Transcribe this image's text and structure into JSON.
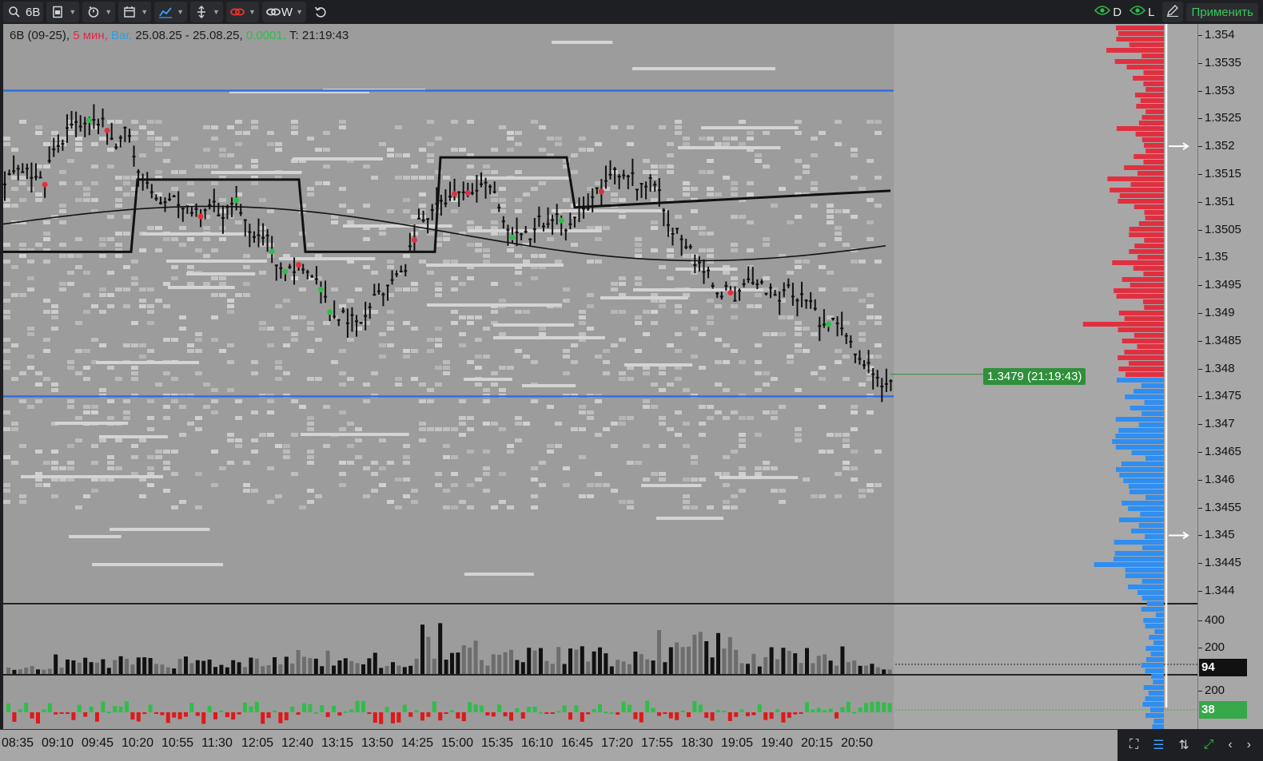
{
  "toolbar": {
    "symbol": "6B",
    "period_link": "W",
    "vis_d": "D",
    "vis_l": "L",
    "apply": "Применить"
  },
  "info": {
    "instrument": "6B  (09-25),",
    "timeframe": "5 мин,",
    "vol_mode": "Ваг,",
    "range": "25.08.25 - 25.08.25,",
    "tick": "0.0001,",
    "time": "T: 21:19:43"
  },
  "last_price_tag": "1.3479 (21:19:43)",
  "price_axis": [
    "1.354",
    "1.3535",
    "1.353",
    "1.3525",
    "1.352",
    "1.3515",
    "1.351",
    "1.3505",
    "1.35",
    "1.3495",
    "1.349",
    "1.3485",
    "1.348",
    "1.3475",
    "1.347",
    "1.3465",
    "1.346",
    "1.3455",
    "1.345",
    "1.3445",
    "1.344"
  ],
  "volume_axis": [
    "400",
    "200"
  ],
  "volume_last": "94",
  "delta_axis": [
    "200"
  ],
  "delta_last": "38",
  "time_axis": [
    "08:35",
    "09:10",
    "09:45",
    "10:20",
    "10:55",
    "11:30",
    "12:05",
    "12:40",
    "13:15",
    "13:50",
    "14:25",
    "15:00",
    "15:35",
    "16:10",
    "16:45",
    "17:20",
    "17:55",
    "18:30",
    "19:05",
    "19:40",
    "20:15",
    "20:50"
  ],
  "colors": {
    "accent_green": "#2fbd49",
    "bid_red": "#e03040",
    "ask_blue": "#2f8ef0",
    "level_blue": "#2f6ee8"
  },
  "chart_data": {
    "type": "candlestick",
    "x": [
      "08:35",
      "09:10",
      "09:45",
      "10:20",
      "10:55",
      "11:30",
      "12:05",
      "12:40",
      "13:15",
      "13:50",
      "14:25",
      "15:00",
      "15:35",
      "16:10",
      "16:45",
      "17:20",
      "17:55",
      "18:30",
      "19:05",
      "19:40",
      "20:15",
      "20:50"
    ],
    "close": [
      1.3514,
      1.3528,
      1.3521,
      1.3513,
      1.3509,
      1.3507,
      1.3499,
      1.3496,
      1.3488,
      1.3493,
      1.3512,
      1.3515,
      1.3504,
      1.3507,
      1.3513,
      1.3511,
      1.3504,
      1.3494,
      1.3492,
      1.3493,
      1.3486,
      1.3479
    ],
    "ylim": [
      1.3438,
      1.3542
    ],
    "horizontal_levels": [
      1.353,
      1.3475
    ],
    "volume": [
      60,
      120,
      110,
      130,
      100,
      90,
      120,
      140,
      110,
      130,
      300,
      190,
      150,
      160,
      170,
      160,
      260,
      240,
      180,
      150,
      170,
      94
    ]
  }
}
